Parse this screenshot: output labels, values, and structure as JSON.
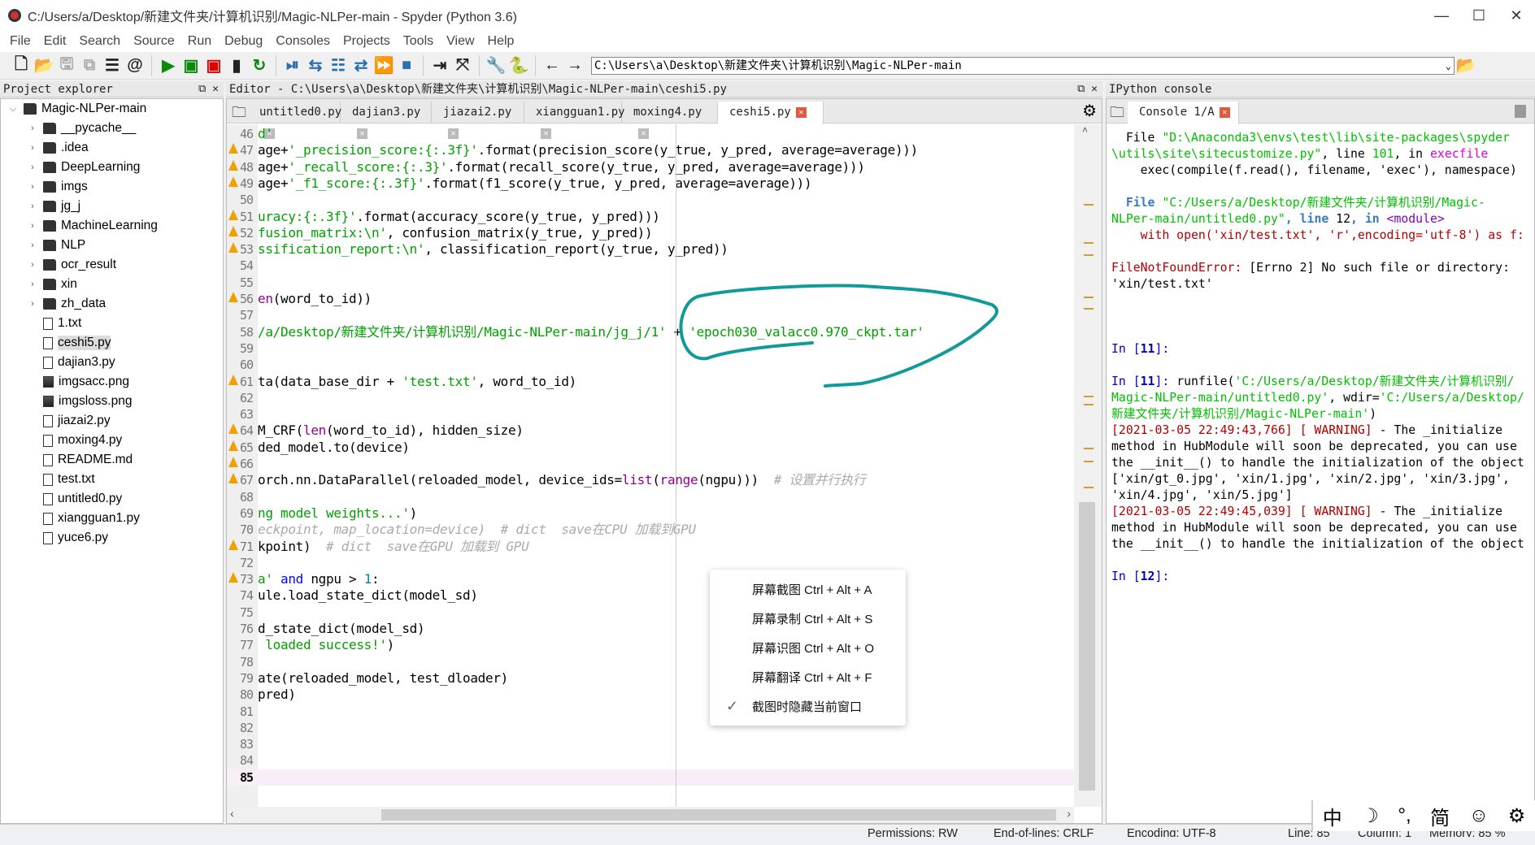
{
  "window": {
    "title": "C:/Users/a/Desktop/新建文件夹/计算机识别/Magic-NLPer-main - Spyder (Python 3.6)",
    "controls": [
      "minimize",
      "maximize",
      "close"
    ]
  },
  "menu": [
    "File",
    "Edit",
    "Search",
    "Source",
    "Run",
    "Debug",
    "Consoles",
    "Projects",
    "Tools",
    "View",
    "Help"
  ],
  "toolbar": {
    "icons": [
      {
        "name": "new-file-icon",
        "glyph": "🗋",
        "color": "#222"
      },
      {
        "name": "open-folder-icon",
        "glyph": "📂",
        "color": "#222"
      },
      {
        "name": "save-icon",
        "glyph": "🖫",
        "color": "#aaa"
      },
      {
        "name": "save-all-icon",
        "glyph": "⧉",
        "color": "#aaa"
      },
      {
        "name": "list-icon",
        "glyph": "☰",
        "color": "#222"
      },
      {
        "name": "at-icon",
        "glyph": "@",
        "color": "#222"
      },
      {
        "sep": true
      },
      {
        "name": "run-icon",
        "glyph": "▶",
        "color": "#0a8a0a"
      },
      {
        "name": "run-cell-icon",
        "glyph": "▣",
        "color": "#0a8a0a"
      },
      {
        "name": "run-cell-advance-icon",
        "glyph": "▣",
        "color": "#d00"
      },
      {
        "name": "run-selection-icon",
        "glyph": "▮",
        "color": "#222"
      },
      {
        "name": "rerun-icon",
        "glyph": "↻",
        "color": "#0a8a0a"
      },
      {
        "sep": true
      },
      {
        "name": "debug-icon",
        "glyph": "⏯",
        "color": "#2a6fb0"
      },
      {
        "name": "step-icon",
        "glyph": "⇆",
        "color": "#2a6fb0"
      },
      {
        "name": "step-into-icon",
        "glyph": "☷",
        "color": "#2a6fb0"
      },
      {
        "name": "step-return-icon",
        "glyph": "⇄",
        "color": "#2a6fb0"
      },
      {
        "name": "continue-icon",
        "glyph": "⏩",
        "color": "#2a6fb0"
      },
      {
        "name": "stop-icon",
        "glyph": "■",
        "color": "#2a6fb0"
      },
      {
        "sep": true
      },
      {
        "name": "maximize-pane-icon",
        "glyph": "⇥",
        "color": "#222"
      },
      {
        "name": "fullscreen-icon",
        "glyph": "⤧",
        "color": "#222"
      },
      {
        "sep": true
      },
      {
        "name": "preferences-wrench-icon",
        "glyph": "🔧",
        "color": "#222"
      },
      {
        "name": "python-path-icon",
        "glyph": "🐍",
        "color": "#e0b020"
      },
      {
        "sep": true
      },
      {
        "name": "back-arrow-icon",
        "glyph": "←",
        "color": "#222"
      },
      {
        "name": "forward-arrow-icon",
        "glyph": "→",
        "color": "#222"
      }
    ],
    "working_dir": "C:\\Users\\a\\Desktop\\新建文件夹\\计算机识别\\Magic-NLPer-main"
  },
  "explorer": {
    "title": "Project explorer",
    "items": [
      {
        "label": "Magic-NLPer-main",
        "type": "folder",
        "depth": 0,
        "expanded": true
      },
      {
        "label": "__pycache__",
        "type": "folder",
        "depth": 1
      },
      {
        "label": ".idea",
        "type": "folder",
        "depth": 1
      },
      {
        "label": "DeepLearning",
        "type": "folder",
        "depth": 1
      },
      {
        "label": "imgs",
        "type": "folder",
        "depth": 1
      },
      {
        "label": "jg_j",
        "type": "folder",
        "depth": 1
      },
      {
        "label": "MachineLearning",
        "type": "folder",
        "depth": 1
      },
      {
        "label": "NLP",
        "type": "folder",
        "depth": 1
      },
      {
        "label": "ocr_result",
        "type": "folder",
        "depth": 1
      },
      {
        "label": "xin",
        "type": "folder",
        "depth": 1
      },
      {
        "label": "zh_data",
        "type": "folder",
        "depth": 1
      },
      {
        "label": "1.txt",
        "type": "file",
        "depth": 1
      },
      {
        "label": "ceshi5.py",
        "type": "file",
        "depth": 1,
        "selected": true
      },
      {
        "label": "dajian3.py",
        "type": "file",
        "depth": 1
      },
      {
        "label": "imgsacc.png",
        "type": "img",
        "depth": 1
      },
      {
        "label": "imgsloss.png",
        "type": "img",
        "depth": 1
      },
      {
        "label": "jiazai2.py",
        "type": "file",
        "depth": 1
      },
      {
        "label": "moxing4.py",
        "type": "file",
        "depth": 1
      },
      {
        "label": "README.md",
        "type": "file",
        "depth": 1
      },
      {
        "label": "test.txt",
        "type": "file",
        "depth": 1
      },
      {
        "label": "untitled0.py",
        "type": "file",
        "depth": 1
      },
      {
        "label": "xiangguan1.py",
        "type": "file",
        "depth": 1
      },
      {
        "label": "yuce6.py",
        "type": "file",
        "depth": 1
      }
    ]
  },
  "editor": {
    "title": "Editor - C:\\Users\\a\\Desktop\\新建文件夹\\计算机识别\\Magic-NLPer-main\\ceshi5.py",
    "tabs": [
      {
        "label": "untitled0.py"
      },
      {
        "label": "dajian3.py"
      },
      {
        "label": "jiazai2.py"
      },
      {
        "label": "xiangguan1.py"
      },
      {
        "label": "moxing4.py"
      },
      {
        "label": "ceshi5.py",
        "active": true
      }
    ],
    "current_line": 85,
    "lines": [
      {
        "n": 46,
        "segs": [
          [
            "d'",
            "s"
          ]
        ]
      },
      {
        "n": 47,
        "w": 1,
        "segs": [
          [
            "age+",
            ""
          ],
          [
            "'_precision_score:{:.3f}'",
            "s"
          ],
          [
            ".format(precision_score(y_true, y_pred, average=average)))",
            ""
          ]
        ]
      },
      {
        "n": 48,
        "w": 1,
        "segs": [
          [
            "age+",
            ""
          ],
          [
            "'_recall_score:{:.3}'",
            "s"
          ],
          [
            ".format(recall_score(y_true, y_pred, average=average)))",
            ""
          ]
        ]
      },
      {
        "n": 49,
        "w": 1,
        "segs": [
          [
            "age+",
            ""
          ],
          [
            "'_f1_score:{:.3f}'",
            "s"
          ],
          [
            ".format(f1_score(y_true, y_pred, average=average)))",
            ""
          ]
        ]
      },
      {
        "n": 50,
        "segs": []
      },
      {
        "n": 51,
        "w": 1,
        "segs": [
          [
            "uracy:{:.3f}'",
            "s"
          ],
          [
            ".format(accuracy_score(y_true, y_pred)))",
            ""
          ]
        ]
      },
      {
        "n": 52,
        "w": 1,
        "segs": [
          [
            "fusion_matrix:\\n'",
            "s"
          ],
          [
            ", confusion_matrix(y_true, y_pred))",
            ""
          ]
        ]
      },
      {
        "n": 53,
        "w": 1,
        "segs": [
          [
            "ssification_report:\\n'",
            "s"
          ],
          [
            ", classification_report(y_true, y_pred))",
            ""
          ]
        ]
      },
      {
        "n": 54,
        "segs": []
      },
      {
        "n": 55,
        "segs": []
      },
      {
        "n": 56,
        "w": 1,
        "segs": [
          [
            "en",
            "b"
          ],
          [
            "(word_to_id))",
            ""
          ]
        ]
      },
      {
        "n": 57,
        "segs": []
      },
      {
        "n": 58,
        "segs": [
          [
            "/a/Desktop/新建文件夹/计算机识别/Magic-NLPer-main/jg_j/1'",
            "s"
          ],
          [
            " + ",
            ""
          ],
          [
            "'epoch030_valacc0.970_ckpt.tar'",
            "s"
          ]
        ]
      },
      {
        "n": 59,
        "segs": []
      },
      {
        "n": 60,
        "segs": []
      },
      {
        "n": 61,
        "w": 1,
        "segs": [
          [
            "ta(data_base_dir + ",
            ""
          ],
          [
            "'test.txt'",
            "s"
          ],
          [
            ", word_to_id)",
            ""
          ]
        ]
      },
      {
        "n": 62,
        "segs": []
      },
      {
        "n": 63,
        "segs": []
      },
      {
        "n": 64,
        "w": 1,
        "segs": [
          [
            "M_CRF(",
            ""
          ],
          [
            "len",
            "b"
          ],
          [
            "(word_to_id), hidden_size)",
            ""
          ]
        ]
      },
      {
        "n": 65,
        "w": 1,
        "segs": [
          [
            "ded_model.to(device)",
            ""
          ]
        ]
      },
      {
        "n": 66,
        "w": 1,
        "segs": []
      },
      {
        "n": 67,
        "w": 1,
        "segs": [
          [
            "orch.nn.DataParallel(reloaded_model, device_ids=",
            ""
          ],
          [
            "list",
            "b"
          ],
          [
            "(",
            ""
          ],
          [
            "range",
            "b"
          ],
          [
            "(ngpu)))  ",
            ""
          ],
          [
            "# 设置并行执行",
            "c"
          ]
        ]
      },
      {
        "n": 68,
        "segs": []
      },
      {
        "n": 69,
        "segs": [
          [
            "ng model weights...'",
            "s"
          ],
          [
            ")",
            ""
          ]
        ]
      },
      {
        "n": 70,
        "segs": [
          [
            "eckpoint, map_location=device)  # dict  save在CPU 加载到GPU",
            "c"
          ]
        ]
      },
      {
        "n": 71,
        "w": 1,
        "segs": [
          [
            "kpoint)  ",
            ""
          ],
          [
            "# dict  save在GPU 加载到 GPU",
            "c"
          ]
        ]
      },
      {
        "n": 72,
        "segs": []
      },
      {
        "n": 73,
        "w": 1,
        "segs": [
          [
            "a'",
            "s"
          ],
          [
            " ",
            ""
          ],
          [
            "and",
            "k"
          ],
          [
            " ngpu > ",
            ""
          ],
          [
            "1",
            "n"
          ],
          [
            ":",
            ""
          ]
        ]
      },
      {
        "n": 74,
        "segs": [
          [
            "ule.load_state_dict(model_sd)",
            ""
          ]
        ]
      },
      {
        "n": 75,
        "segs": []
      },
      {
        "n": 76,
        "segs": [
          [
            "d_state_dict(model_sd)",
            ""
          ]
        ]
      },
      {
        "n": 77,
        "segs": [
          [
            " loaded success!'",
            "s"
          ],
          [
            ")",
            ""
          ]
        ]
      },
      {
        "n": 78,
        "segs": []
      },
      {
        "n": 79,
        "segs": [
          [
            "ate(reloaded_model, test_dloader)",
            ""
          ]
        ]
      },
      {
        "n": 80,
        "segs": [
          [
            "pred)",
            ""
          ]
        ]
      },
      {
        "n": 81,
        "segs": []
      },
      {
        "n": 82,
        "segs": []
      },
      {
        "n": 83,
        "segs": []
      },
      {
        "n": 84,
        "segs": []
      },
      {
        "n": 85,
        "segs": []
      }
    ]
  },
  "console": {
    "title": "IPython console",
    "tab": "Console 1/A",
    "lines": [
      [
        [
          "  File ",
          ""
        ],
        [
          "\"D:\\Anaconda3\\envs\\test\\lib\\site-packages\\spyder",
          "cg"
        ]
      ],
      [
        [
          "\\utils\\site\\sitecustomize.py\"",
          "cg"
        ],
        [
          ", line ",
          ""
        ],
        [
          "101",
          "cg"
        ],
        [
          ", in ",
          ""
        ],
        [
          "execfile",
          "cm"
        ]
      ],
      [
        [
          "    exec(compile(f.read(), filename, 'exec'), namespace)",
          ""
        ]
      ],
      [
        [
          "",
          ""
        ]
      ],
      [
        [
          "  File ",
          "cblue"
        ],
        [
          "\"C:/Users/a/Desktop/新建文件夹/计算机识别/Magic-",
          "cg"
        ]
      ],
      [
        [
          "NLPer-main/untitled0.py\"",
          "cg"
        ],
        [
          ", line ",
          "cblue"
        ],
        [
          "12",
          ""
        ],
        [
          ", in ",
          "cblue"
        ],
        [
          "<module>",
          "cp"
        ]
      ],
      [
        [
          "    with open('xin/test.txt', 'r',encoding='utf-8') as f:",
          "cr"
        ]
      ],
      [
        [
          "",
          ""
        ]
      ],
      [
        [
          "FileNotFoundError:",
          "cr"
        ],
        [
          " [Errno 2] No such file or directory:",
          ""
        ]
      ],
      [
        [
          "'xin/test.txt'",
          ""
        ]
      ],
      [
        [
          "",
          ""
        ]
      ],
      [
        [
          "",
          ""
        ]
      ],
      [
        [
          "",
          ""
        ]
      ],
      [
        [
          "In [",
          "cb"
        ],
        [
          "11",
          "cb b"
        ],
        [
          "]:",
          "cb"
        ]
      ],
      [
        [
          "",
          ""
        ]
      ],
      [
        [
          "In [",
          "cb"
        ],
        [
          "11",
          "cb b"
        ],
        [
          "]: ",
          "cb"
        ],
        [
          "runfile(",
          ""
        ],
        [
          "'C:/Users/a/Desktop/新建文件夹/计算机识别/",
          "cg"
        ]
      ],
      [
        [
          "Magic-NLPer-main/untitled0.py'",
          "cg"
        ],
        [
          ", wdir=",
          ""
        ],
        [
          "'C:/Users/a/Desktop/",
          "cg"
        ]
      ],
      [
        [
          "新建文件夹/计算机识别/Magic-NLPer-main'",
          "cg"
        ],
        [
          ")",
          ""
        ]
      ],
      [
        [
          "[2021-03-05 22:49:43,766] [ WARNING]",
          "cr"
        ],
        [
          " - The _initialize",
          ""
        ]
      ],
      [
        [
          "method in HubModule will soon be deprecated, you can use",
          ""
        ]
      ],
      [
        [
          "the __init__() to handle the initialization of the object",
          ""
        ]
      ],
      [
        [
          "['xin/gt_0.jpg', 'xin/1.jpg', 'xin/2.jpg', 'xin/3.jpg',",
          ""
        ]
      ],
      [
        [
          "'xin/4.jpg', 'xin/5.jpg']",
          ""
        ]
      ],
      [
        [
          "[2021-03-05 22:49:45,039] [ WARNING]",
          "cr"
        ],
        [
          " - The _initialize",
          ""
        ]
      ],
      [
        [
          "method in HubModule will soon be deprecated, you can use",
          ""
        ]
      ],
      [
        [
          "the __init__() to handle the initialization of the object",
          ""
        ]
      ],
      [
        [
          "",
          ""
        ]
      ],
      [
        [
          "In [",
          "cb"
        ],
        [
          "12",
          "cb b"
        ],
        [
          "]:",
          "cb"
        ]
      ]
    ]
  },
  "context_menu": {
    "items": [
      {
        "label": "屏幕截图 Ctrl + Alt + A"
      },
      {
        "label": "屏幕录制 Ctrl + Alt + S"
      },
      {
        "label": "屏幕识图 Ctrl + Alt + O"
      },
      {
        "label": "屏幕翻译 Ctrl + Alt + F"
      },
      {
        "label": "截图时隐藏当前窗口",
        "checked": true
      }
    ]
  },
  "ime_toolbar": [
    "中",
    "☽",
    "°,",
    "简",
    "☺",
    "⚙"
  ],
  "status": {
    "permissions": "Permissions: RW",
    "eol": "End-of-lines: CRLF",
    "encoding": "Encoding: UTF-8",
    "line": "Line: 85",
    "column": "Column: 1",
    "memory": "Memory: 85 %"
  },
  "annotation_color": "#129a9a"
}
